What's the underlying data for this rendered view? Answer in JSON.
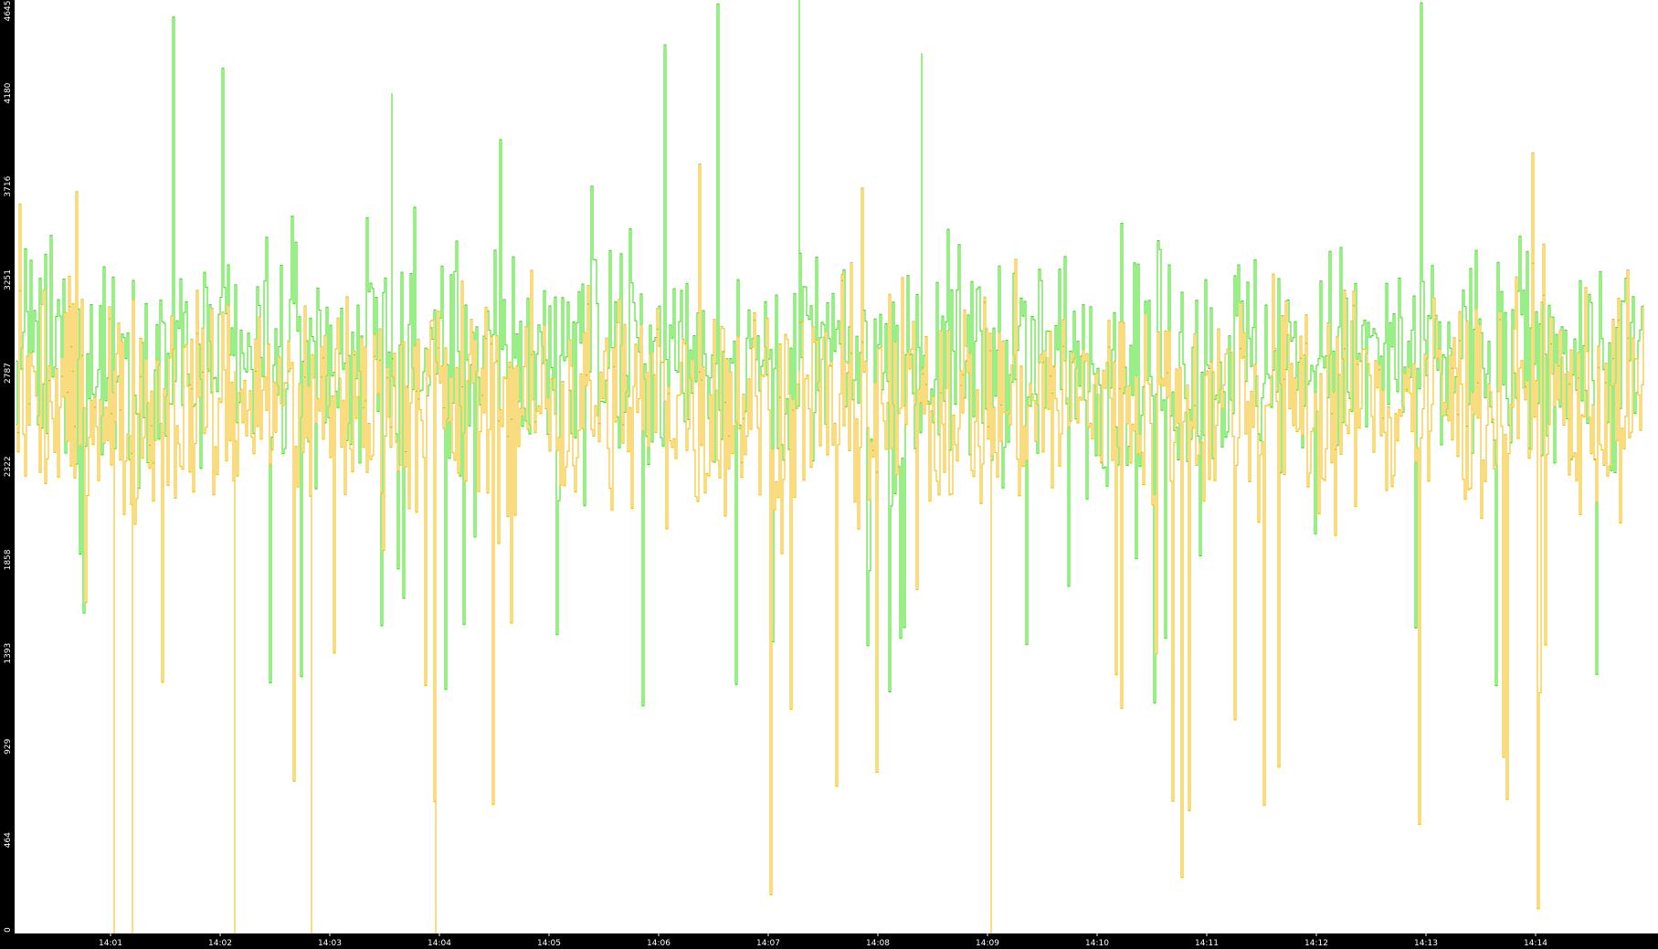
{
  "chart_data": {
    "type": "line",
    "title": "",
    "xlabel": "",
    "ylabel": "",
    "ylim": [
      0,
      4645
    ],
    "grid": false,
    "legend": "none",
    "y_ticks": [
      "0",
      "464",
      "929",
      "1393",
      "1858",
      "2322",
      "2787",
      "3251",
      "3716",
      "4180",
      "4645"
    ],
    "x_ticks": [
      "14:01",
      "14:02",
      "14:03",
      "14:04",
      "14:05",
      "14:06",
      "14:07",
      "14:08",
      "14:09",
      "14:10",
      "14:11",
      "14:12",
      "14:13",
      "14:14"
    ],
    "x_range": [
      "14:00:00",
      "14:14:59"
    ],
    "series": [
      {
        "color": "#33dd11",
        "typical_range": [
          2000,
          3700
        ],
        "max": 4645,
        "min": 1100
      },
      {
        "color": "#f5b800",
        "typical_range": [
          1800,
          3500
        ],
        "max": 3900,
        "min": 0
      }
    ]
  }
}
